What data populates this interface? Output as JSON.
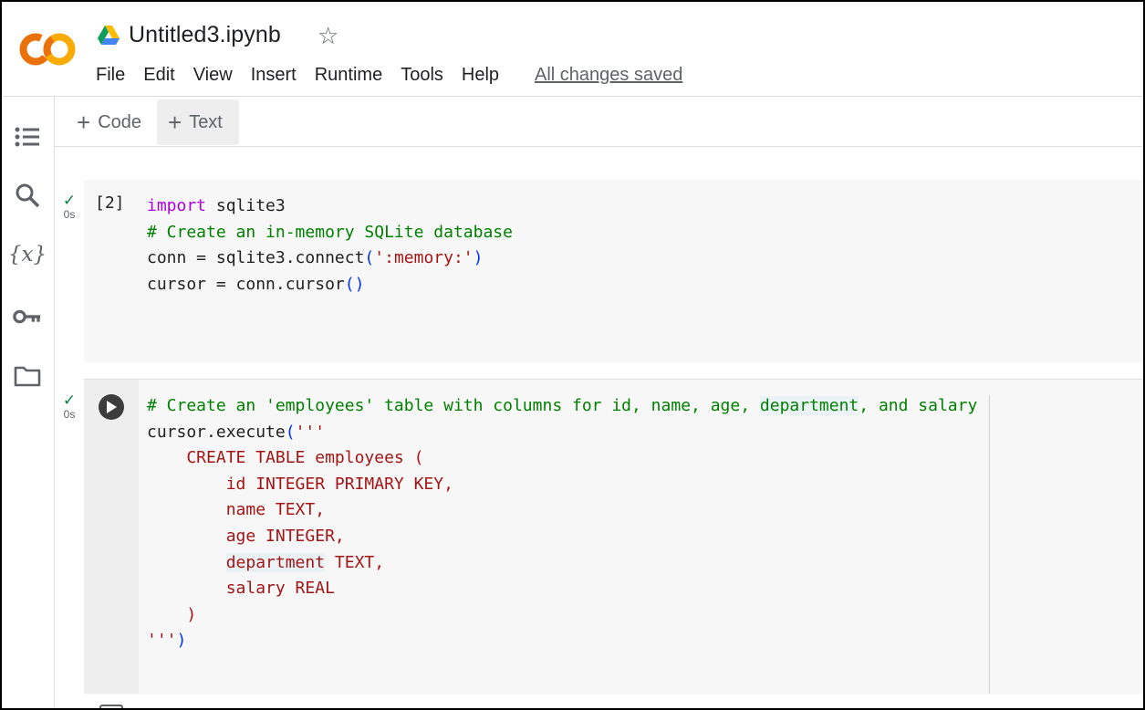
{
  "header": {
    "title": "Untitled3.ipynb",
    "menu": [
      "File",
      "Edit",
      "View",
      "Insert",
      "Runtime",
      "Tools",
      "Help"
    ],
    "save_status": "All changes saved"
  },
  "sidebar": {
    "icons": [
      "table-of-contents-icon",
      "search-icon",
      "variables-icon",
      "key-icon",
      "folder-icon"
    ],
    "variables_glyph": "{x}"
  },
  "toolbar": {
    "add_code_label": "Code",
    "add_text_label": "Text",
    "plus": "+"
  },
  "cells": [
    {
      "exec_count": "[2]",
      "status_time": "0s",
      "lines": [
        [
          {
            "t": "import",
            "c": "kw"
          },
          {
            "t": " sqlite3",
            "c": ""
          }
        ],
        [
          {
            "t": "# Create an in-memory SQLite database",
            "c": "cm"
          }
        ],
        [
          {
            "t": "conn = sqlite3.connect",
            "c": ""
          },
          {
            "t": "(",
            "c": "pn"
          },
          {
            "t": "':memory:'",
            "c": "st"
          },
          {
            "t": ")",
            "c": "pn"
          }
        ],
        [
          {
            "t": "cursor = conn.cursor",
            "c": ""
          },
          {
            "t": "()",
            "c": "pn"
          }
        ]
      ]
    },
    {
      "exec_count": "",
      "status_time": "0s",
      "lines": [
        [
          {
            "t": "# Create an 'employees' table with columns for id, name, age, ",
            "c": "cm"
          },
          {
            "t": "department",
            "c": "cm hl"
          },
          {
            "t": ", and salary",
            "c": "cm"
          }
        ],
        [
          {
            "t": "cursor.execute",
            "c": ""
          },
          {
            "t": "(",
            "c": "pn"
          },
          {
            "t": "'''",
            "c": "st"
          }
        ],
        [
          {
            "t": "    CREATE TABLE employees (",
            "c": "st"
          }
        ],
        [
          {
            "t": "        id INTEGER PRIMARY KEY,",
            "c": "st"
          }
        ],
        [
          {
            "t": "        name TEXT,",
            "c": "st"
          }
        ],
        [
          {
            "t": "        age INTEGER,",
            "c": "st"
          }
        ],
        [
          {
            "t": "        ",
            "c": "st"
          },
          {
            "t": "department",
            "c": "st hl"
          },
          {
            "t": " TEXT,",
            "c": "st"
          }
        ],
        [
          {
            "t": "        salary REAL",
            "c": "st"
          }
        ],
        [
          {
            "t": "    )",
            "c": "st"
          }
        ],
        [
          {
            "t": "'''",
            "c": "st"
          },
          {
            "t": ")",
            "c": "pn"
          }
        ]
      ]
    }
  ],
  "colors": {
    "keyword": "#af00db",
    "comment": "#008000",
    "string": "#a31515",
    "paren": "#0431fa",
    "check": "#0b8043",
    "logo_orange": "#f9ab00",
    "logo_dark_orange": "#e8710a"
  }
}
